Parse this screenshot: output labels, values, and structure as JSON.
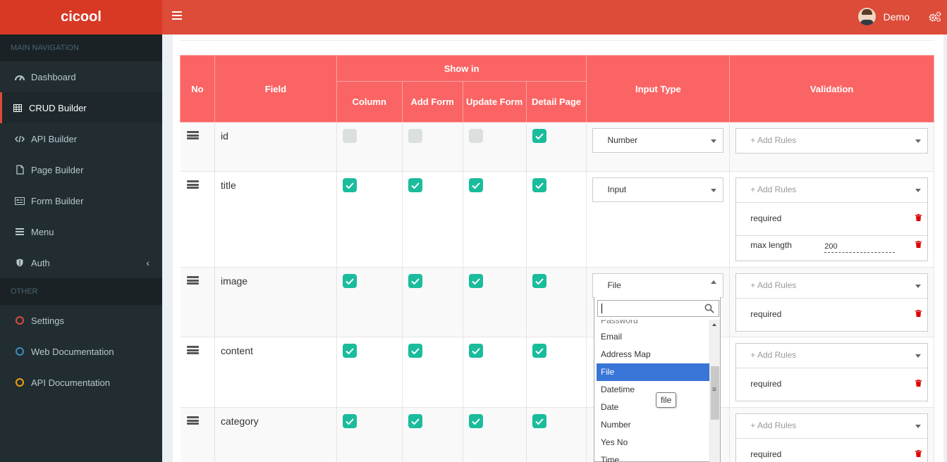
{
  "app": {
    "logo": "cicool"
  },
  "header": {
    "user_name": "Demo"
  },
  "sidebar": {
    "sections": [
      {
        "title": "MAIN NAVIGATION"
      },
      {
        "title": "OTHER"
      }
    ],
    "items": [
      {
        "label": "Dashboard",
        "icon": "dashboard-icon"
      },
      {
        "label": "CRUD Builder",
        "icon": "table-icon",
        "active": true
      },
      {
        "label": "API Builder",
        "icon": "code-icon"
      },
      {
        "label": "Page Builder",
        "icon": "file-icon"
      },
      {
        "label": "Form Builder",
        "icon": "form-icon"
      },
      {
        "label": "Menu",
        "icon": "bars-icon"
      },
      {
        "label": "Auth",
        "icon": "shield-icon"
      },
      {
        "label": "Settings",
        "icon": "circle-icon",
        "color": "#dd4b39"
      },
      {
        "label": "Web Documentation",
        "icon": "circle-icon",
        "color": "#3c8dbc"
      },
      {
        "label": "API Documentation",
        "icon": "circle-icon",
        "color": "#f39c12"
      }
    ]
  },
  "table": {
    "headers": {
      "no": "No",
      "field": "Field",
      "show_in": "Show in",
      "column": "Column",
      "add_form": "Add Form",
      "update_form": "Update Form",
      "detail_page": "Detail Page",
      "input_type": "Input Type",
      "validation": "Validation"
    },
    "add_rules_placeholder": "+ Add Rules",
    "rows": [
      {
        "field": "id",
        "column": false,
        "add_form": false,
        "update_form": false,
        "detail_page": true,
        "input_type": "Number",
        "rules": []
      },
      {
        "field": "title",
        "column": true,
        "add_form": true,
        "update_form": true,
        "detail_page": true,
        "input_type": "Input",
        "rules": [
          {
            "label": "required"
          },
          {
            "label": "max length",
            "value": "200"
          }
        ]
      },
      {
        "field": "image",
        "column": true,
        "add_form": true,
        "update_form": true,
        "detail_page": true,
        "input_type": "File",
        "rules": [
          {
            "label": "required"
          }
        ]
      },
      {
        "field": "content",
        "column": true,
        "add_form": true,
        "update_form": true,
        "detail_page": true,
        "input_type": "",
        "rules": [
          {
            "label": "required"
          }
        ]
      },
      {
        "field": "category",
        "column": true,
        "add_form": true,
        "update_form": true,
        "detail_page": true,
        "input_type": "",
        "rules": [
          {
            "label": "required"
          }
        ]
      }
    ]
  },
  "dropdown": {
    "search_value": "",
    "options": [
      "Password",
      "Email",
      "Address Map",
      "File",
      "Datetime",
      "Date",
      "Number",
      "Yes No",
      "Time"
    ],
    "highlighted": "File",
    "tooltip": "file"
  },
  "colors": {
    "header": "#dd4b39",
    "logo_bg": "#d73925",
    "sidebar": "#222d32",
    "table_header": "#fb6464",
    "checkbox_on": "#1abc9c",
    "highlight": "#3875d7"
  }
}
